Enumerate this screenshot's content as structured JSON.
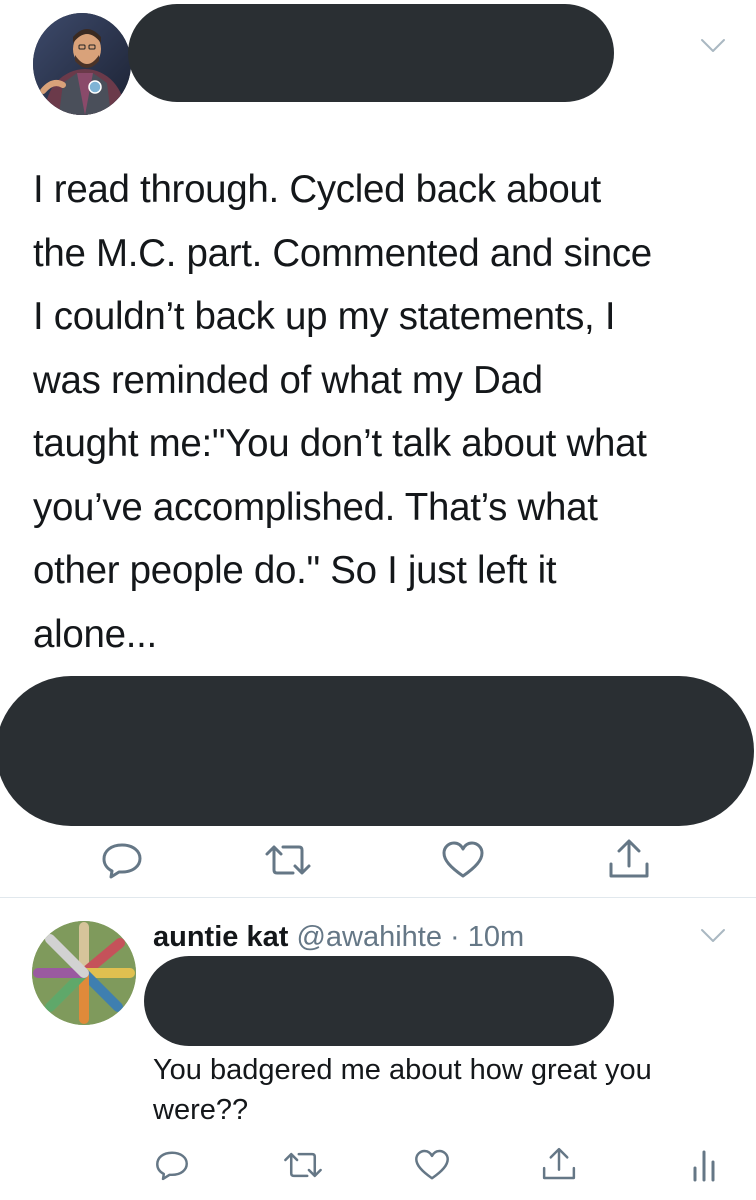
{
  "main_tweet": {
    "text": "I read through. Cycled back about\nthe M.C. part. Commented and since\nI couldn’t back up my statements, I\nwas reminded of what my Dad\ntaught me:\"You don’t talk about what\nyou’ve accomplished. That’s what\nother people do.\" So I just left it\nalone...",
    "actions": [
      "reply-icon",
      "retweet-icon",
      "like-icon",
      "share-icon"
    ]
  },
  "reply": {
    "display_name": "auntie kat",
    "handle": "@awahihte",
    "separator": "·",
    "time": "10m",
    "text": "You badgered me about how great you were??",
    "actions": [
      "reply-icon",
      "retweet-icon",
      "like-icon",
      "share-icon",
      "analytics-icon"
    ]
  },
  "colors": {
    "text": "#14171a",
    "secondary": "#657786",
    "icon": "#657786",
    "redaction": "#2a2f33",
    "divider": "#e1e8ed"
  }
}
